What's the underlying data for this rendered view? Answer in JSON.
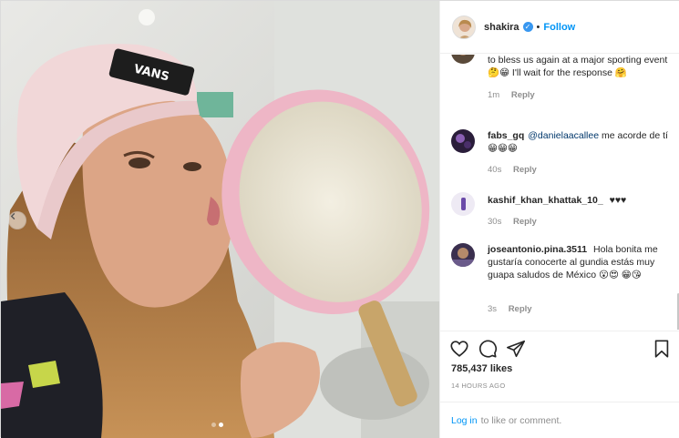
{
  "post": {
    "author": "shakira",
    "separator": "•",
    "follow_label": "Follow",
    "verified_mark": "✓"
  },
  "carousel": {
    "slides": 2,
    "active_index": 1
  },
  "comments": [
    {
      "user": "",
      "text": "to bless us again at a major sporting event 🤔😁 I'll wait for the response 🤗",
      "time": "1m",
      "reply": "Reply"
    },
    {
      "user": "fabs_gq",
      "mention": "@danielaacallee",
      "text": "me acorde de tí 😁😁😁",
      "time": "40s",
      "reply": "Reply"
    },
    {
      "user": "kashif_khan_khattak_10_",
      "text": "♥♥♥",
      "time": "30s",
      "reply": "Reply"
    },
    {
      "user": "joseantonio.pina.3511",
      "text": "Hola bonita me gustaría conocerte al gundia estás muy guapa saludos de México 😮😍 😁😘",
      "time": "3s",
      "reply": "Reply"
    }
  ],
  "stats": {
    "likes": "785,437 likes",
    "time_ago": "14 HOURS AGO"
  },
  "login": {
    "link": "Log in",
    "text": "to like or comment."
  },
  "icons": {
    "like": "heart-icon",
    "comment": "comment-icon",
    "share": "share-icon",
    "save": "bookmark-icon",
    "prev": "chevron-left-icon"
  }
}
